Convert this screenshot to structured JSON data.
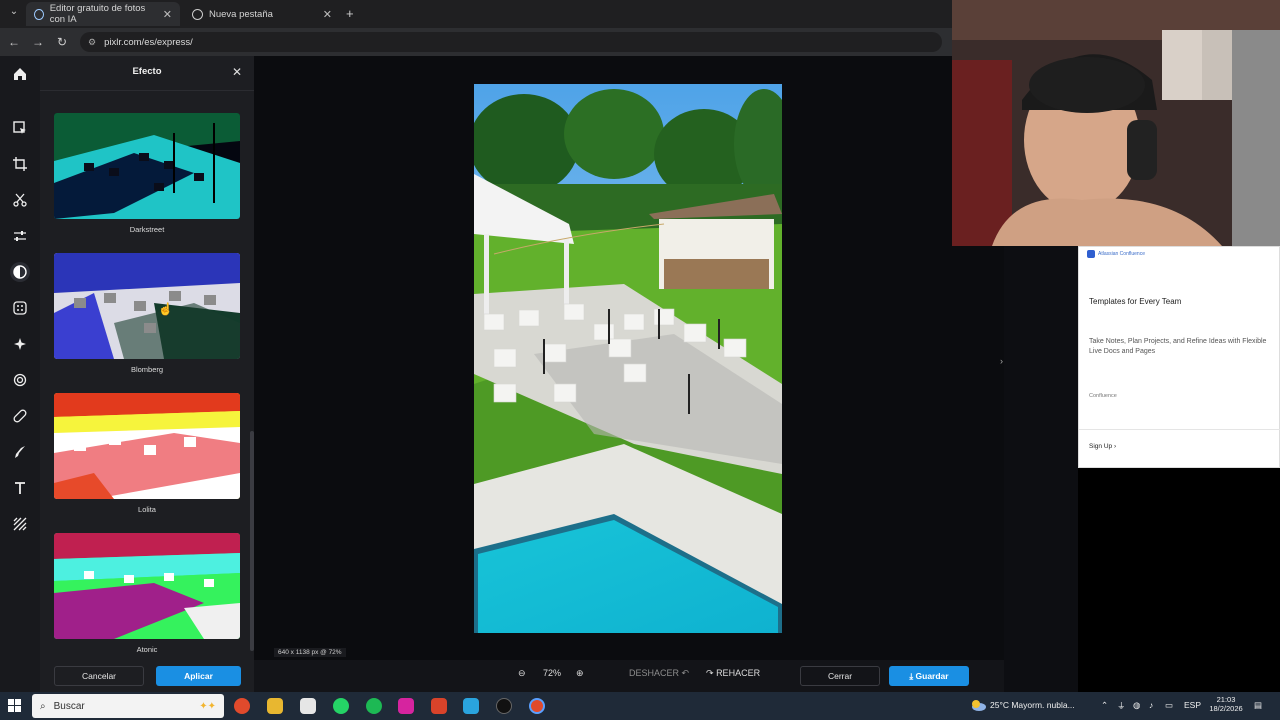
{
  "browser": {
    "tabs": [
      {
        "title": "Editor gratuito de fotos con IA",
        "active": true
      },
      {
        "title": "Nueva pestaña",
        "active": false
      }
    ],
    "url": "pixlr.com/es/express/"
  },
  "panel": {
    "title": "Efecto",
    "effects": [
      {
        "label": "Darkstreet"
      },
      {
        "label": "Blomberg"
      },
      {
        "label": "Lolita"
      },
      {
        "label": "Atonic"
      }
    ],
    "cancel_label": "Cancelar",
    "apply_label": "Aplicar"
  },
  "canvas": {
    "dimensions_label": "640 x 1138 px @ 72%"
  },
  "bottombar": {
    "zoom": "72%",
    "undo_label": "DESHACER",
    "redo_label": "REHACER",
    "close_label": "Cerrar",
    "save_label": "Guardar"
  },
  "ad": {
    "logo_text": "Atlassian Confluence",
    "title": "Templates for Every Team",
    "body": "Take Notes, Plan Projects, and Refine Ideas with Flexible Live Docs and Pages",
    "brand": "Confluence",
    "signup": "Sign Up"
  },
  "taskbar": {
    "search_placeholder": "Buscar",
    "weather": "25°C  Mayorm. nubla...",
    "lang": "ESP",
    "time": "21:03",
    "date": "18/2/2026"
  },
  "colors": {
    "accent": "#1a8fe3",
    "panel_bg": "#1d1e22"
  }
}
